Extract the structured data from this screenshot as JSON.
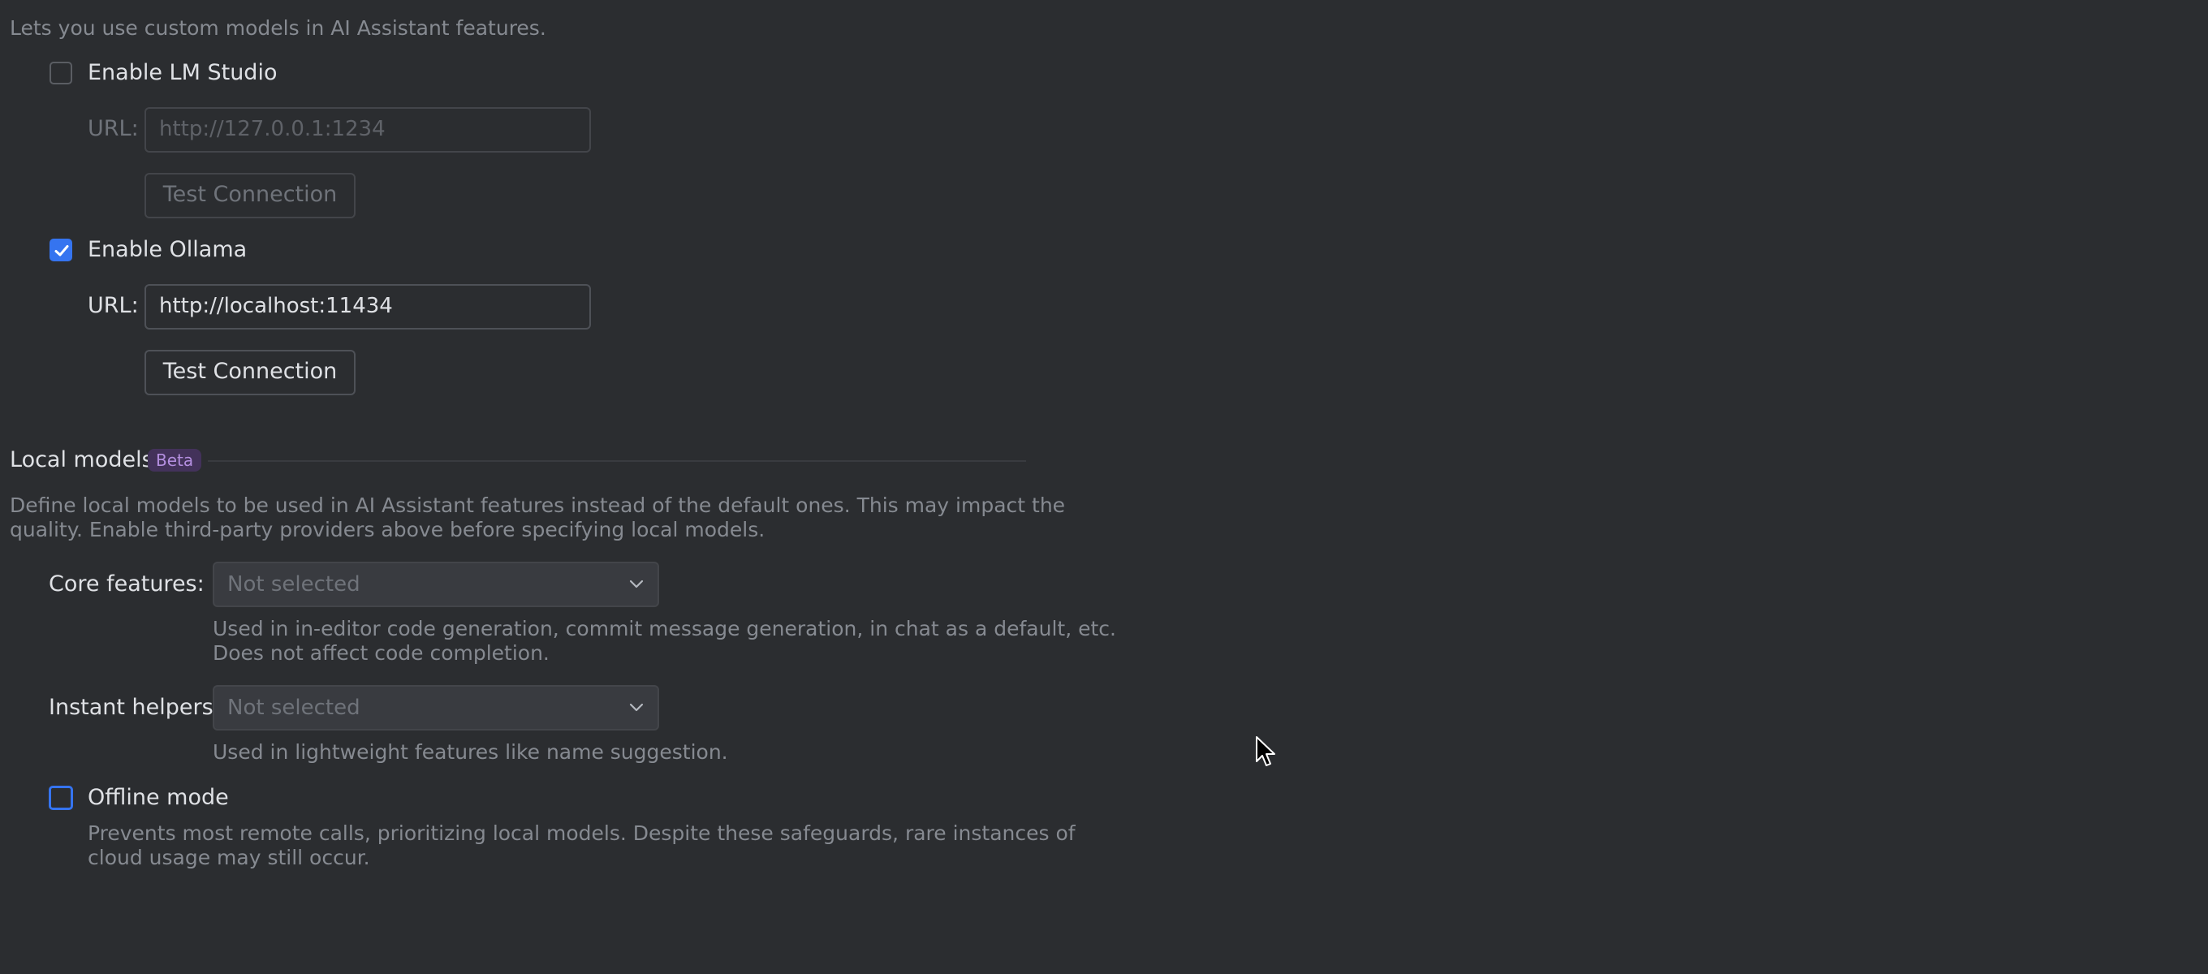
{
  "intro_text": "Lets you use custom models in AI Assistant features.",
  "lm_studio": {
    "enable_label": "Enable LM Studio",
    "checked": false,
    "url_label": "URL:",
    "url_placeholder": "http://127.0.0.1:1234",
    "test_button": "Test Connection"
  },
  "ollama": {
    "enable_label": "Enable Ollama",
    "checked": true,
    "url_label": "URL:",
    "url_value": "http://localhost:11434",
    "test_button": "Test Connection"
  },
  "local_models": {
    "title": "Local models",
    "badge": "Beta",
    "description_line1": "Define local models to be used in AI Assistant features instead of the default ones. This may impact the",
    "description_line2": "quality. Enable third-party providers above before specifying local models.",
    "core_features": {
      "label": "Core features:",
      "selected": "Not selected",
      "help_line1": "Used in in-editor code generation, commit message generation, in chat as a default, etc.",
      "help_line2": "Does not affect code completion."
    },
    "instant_helpers": {
      "label": "Instant helpers:",
      "selected": "Not selected",
      "help_line1": "Used in lightweight features like name suggestion."
    }
  },
  "offline_mode": {
    "label": "Offline mode",
    "checked": false,
    "help_line1": "Prevents most remote calls, prioritizing local models. Despite these safeguards, rare instances of",
    "help_line2": "cloud usage may still occur."
  },
  "colors": {
    "background": "#2b2d30",
    "accent": "#3574f0",
    "badge_bg": "#43325a",
    "badge_text": "#b48fe0"
  }
}
